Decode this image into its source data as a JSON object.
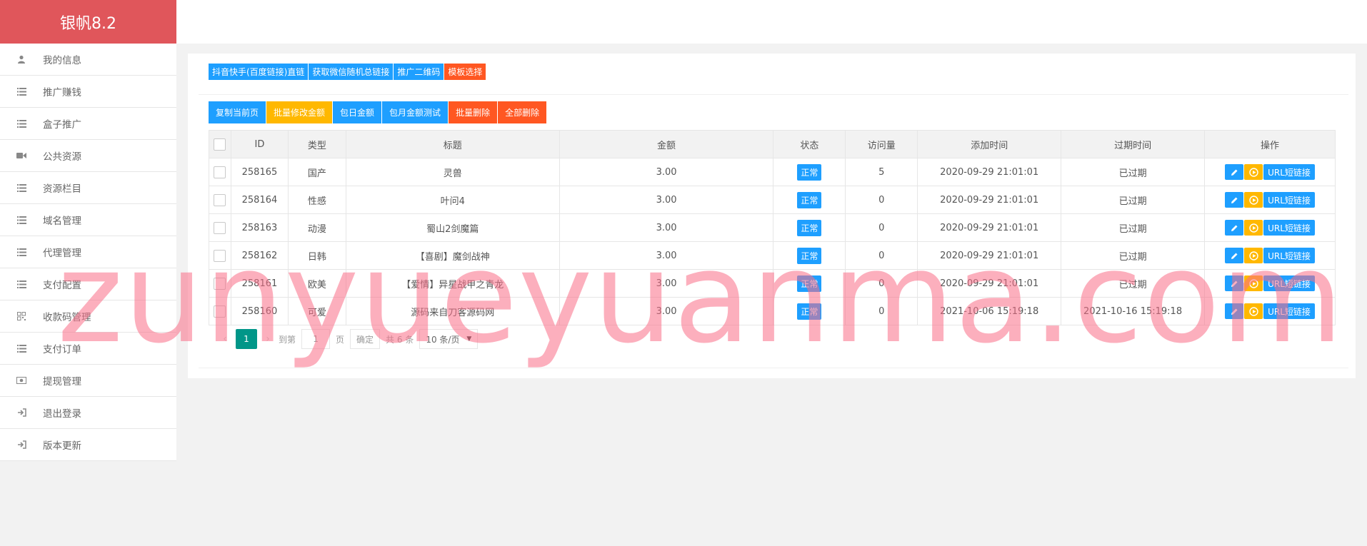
{
  "brand": {
    "title": "银帆8.2",
    "color": "#e0565b"
  },
  "sidebar": {
    "items": [
      {
        "label": "我的信息",
        "icon": "user-icon"
      },
      {
        "label": "推广赚钱",
        "icon": "list-icon"
      },
      {
        "label": "盒子推广",
        "icon": "list-icon"
      },
      {
        "label": "公共资源",
        "icon": "video-icon"
      },
      {
        "label": "资源栏目",
        "icon": "list-icon"
      },
      {
        "label": "域名管理",
        "icon": "list-icon"
      },
      {
        "label": "代理管理",
        "icon": "list-icon"
      },
      {
        "label": "支付配置",
        "icon": "list-icon"
      },
      {
        "label": "收款码管理",
        "icon": "qrcode-icon"
      },
      {
        "label": "支付订单",
        "icon": "list-icon"
      },
      {
        "label": "提现管理",
        "icon": "money-icon"
      },
      {
        "label": "退出登录",
        "icon": "sign-in-icon"
      },
      {
        "label": "版本更新",
        "icon": "sign-in-icon"
      }
    ]
  },
  "toolbar_top": [
    {
      "label": "抖音快手(百度链接)直链",
      "color": "blue"
    },
    {
      "label": "获取微信随机总链接",
      "color": "blue"
    },
    {
      "label": "推广二维码",
      "color": "blue"
    },
    {
      "label": "模板选择",
      "color": "orange"
    }
  ],
  "toolbar_actions": [
    {
      "label": "复制当前页",
      "color": "blue"
    },
    {
      "label": "批量修改金额",
      "color": "yellow"
    },
    {
      "label": "包日金额",
      "color": "blue"
    },
    {
      "label": "包月金额测试",
      "color": "blue"
    },
    {
      "label": "批量删除",
      "color": "orange"
    },
    {
      "label": "全部删除",
      "color": "orange"
    }
  ],
  "table": {
    "headers": [
      "ID",
      "类型",
      "标题",
      "金额",
      "状态",
      "访问量",
      "添加时间",
      "过期时间",
      "操作"
    ],
    "rows": [
      {
        "id": "258165",
        "type": "国产",
        "title": "灵兽",
        "amount": "3.00",
        "status": "正常",
        "visits": "5",
        "added": "2020-09-29 21:01:01",
        "expires": "已过期",
        "expired": true
      },
      {
        "id": "258164",
        "type": "性感",
        "title": "叶问4",
        "amount": "3.00",
        "status": "正常",
        "visits": "0",
        "added": "2020-09-29 21:01:01",
        "expires": "已过期",
        "expired": true
      },
      {
        "id": "258163",
        "type": "动漫",
        "title": "蜀山2剑魔篇",
        "amount": "3.00",
        "status": "正常",
        "visits": "0",
        "added": "2020-09-29 21:01:01",
        "expires": "已过期",
        "expired": true
      },
      {
        "id": "258162",
        "type": "日韩",
        "title": "【喜剧】魔剑战神",
        "amount": "3.00",
        "status": "正常",
        "visits": "0",
        "added": "2020-09-29 21:01:01",
        "expires": "已过期",
        "expired": true
      },
      {
        "id": "258161",
        "type": "欧美",
        "title": "【爱情】异星战甲之青龙",
        "amount": "3.00",
        "status": "正常",
        "visits": "0",
        "added": "2020-09-29 21:01:01",
        "expires": "已过期",
        "expired": true
      },
      {
        "id": "258160",
        "type": "可爱",
        "title": "源码来自刀客源码网",
        "amount": "3.00",
        "status": "正常",
        "visits": "0",
        "added": "2021-10-06 15:19:18",
        "expires": "2021-10-16 15:19:18",
        "expired": false
      }
    ],
    "url_button_label": "URL短链接"
  },
  "pager": {
    "current": "1",
    "goto_label": "到第",
    "page_input": "1",
    "page_suffix": "页",
    "confirm_label": "确定",
    "total_label": "共 6 条",
    "page_size": "10 条/页"
  },
  "watermark": "zunyueyuanma.com",
  "colors": {
    "blue": "#1e9fff",
    "orange": "#ff5722",
    "yellow": "#ffb800",
    "green": "#009688",
    "red": "#ff0000"
  }
}
